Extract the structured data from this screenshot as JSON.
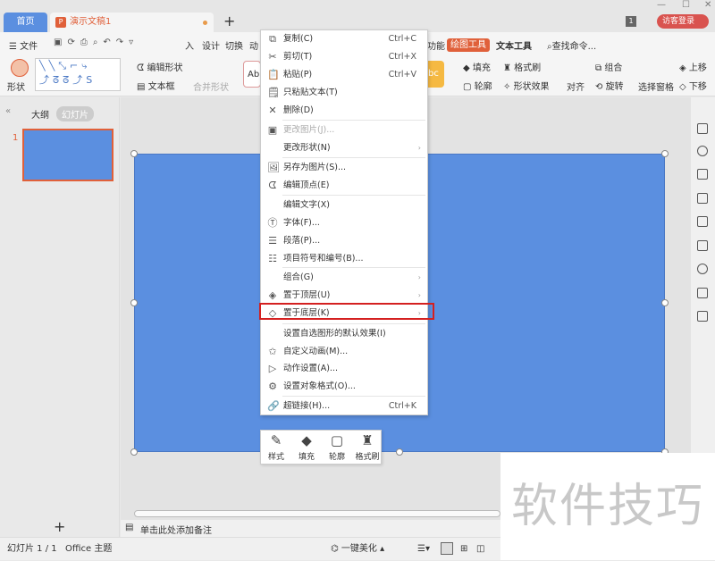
{
  "titlebar": {
    "home_tab": "首页",
    "doc_tab": "演示文稿1",
    "new_tab": "+",
    "badge": "1",
    "login": "访客登录",
    "window": [
      "—",
      "☐",
      "✕"
    ]
  },
  "menubar": {
    "file": "文件",
    "tabs": [
      "入",
      "设计",
      "切换",
      "动",
      "功能"
    ],
    "drawing_tools": "绘图工具",
    "text_tools": "文本工具",
    "search": "查找命令..."
  },
  "ribbon": {
    "shape": "形状",
    "edit_shape": "编辑形状",
    "text_box": "文本框",
    "merge_shape": "合并形状",
    "fill": "填充",
    "format_painter": "格式刷",
    "outline": "轮廓",
    "shape_effect": "形状效果",
    "align": "对齐",
    "group": "组合",
    "rotate": "旋转",
    "selection_pane": "选择窗格",
    "move_up": "上移",
    "move_down": "下移",
    "style_sample": "Ab",
    "style_sample2": "bc"
  },
  "leftpane": {
    "outline_tab": "大纲",
    "slides_tab": "幻灯片",
    "slide_number": "1",
    "add": "+"
  },
  "context_menu": {
    "items": [
      {
        "label": "复制(C)",
        "shortcut": "Ctrl+C",
        "icon": "copy-icon",
        "glyph": "⧉"
      },
      {
        "label": "剪切(T)",
        "shortcut": "Ctrl+X",
        "icon": "scissors-icon",
        "glyph": "✂"
      },
      {
        "label": "粘贴(P)",
        "shortcut": "Ctrl+V",
        "icon": "paste-icon",
        "glyph": "📋"
      },
      {
        "label": "只粘贴文本(T)",
        "icon": "paste-text-icon",
        "glyph": "🗒"
      },
      {
        "label": "删除(D)",
        "icon": "delete-icon",
        "glyph": "✕"
      },
      {
        "label": "更改图片(J)...",
        "icon": "change-picture-icon",
        "glyph": "▣",
        "disabled": true
      },
      {
        "label": "更改形状(N)",
        "submenu": true
      },
      {
        "label": "另存为图片(S)...",
        "icon": "save-image-icon",
        "glyph": "🖼"
      },
      {
        "label": "编辑顶点(E)",
        "icon": "edit-points-icon",
        "glyph": "ᗧ"
      },
      {
        "label": "编辑文字(X)"
      },
      {
        "label": "字体(F)...",
        "icon": "font-icon",
        "glyph": "Ⓣ"
      },
      {
        "label": "段落(P)...",
        "icon": "paragraph-icon",
        "glyph": "☰"
      },
      {
        "label": "项目符号和编号(B)...",
        "icon": "bullets-icon",
        "glyph": "☷"
      },
      {
        "label": "组合(G)",
        "submenu": true
      },
      {
        "label": "置于顶层(U)",
        "submenu": true,
        "icon": "bring-front-icon",
        "glyph": "◈"
      },
      {
        "label": "置于底层(K)",
        "submenu": true,
        "icon": "send-back-icon",
        "glyph": "◇"
      },
      {
        "label": "设置自选图形的默认效果(I)"
      },
      {
        "label": "自定义动画(M)...",
        "icon": "animation-icon",
        "glyph": "✩"
      },
      {
        "label": "动作设置(A)...",
        "icon": "action-icon",
        "glyph": "▷"
      },
      {
        "label": "设置对象格式(O)...",
        "icon": "format-object-icon",
        "glyph": "⚙"
      },
      {
        "label": "超链接(H)...",
        "shortcut": "Ctrl+K",
        "icon": "link-icon",
        "glyph": "🔗"
      }
    ]
  },
  "mini_toolbar": [
    {
      "label": "样式",
      "glyph": "✎"
    },
    {
      "label": "填充",
      "glyph": "◆"
    },
    {
      "label": "轮廓",
      "glyph": "▢"
    },
    {
      "label": "格式刷",
      "glyph": "♜"
    }
  ],
  "notes": {
    "placeholder": "单击此处添加备注"
  },
  "status": {
    "slide": "幻灯片 1 / 1",
    "theme": "Office 主题",
    "beautify": "一键美化"
  },
  "watermark": "软件技巧",
  "colors": {
    "accent": "#e0603a",
    "slide_fill": "#5b8fe0",
    "highlight": "#d42020"
  }
}
